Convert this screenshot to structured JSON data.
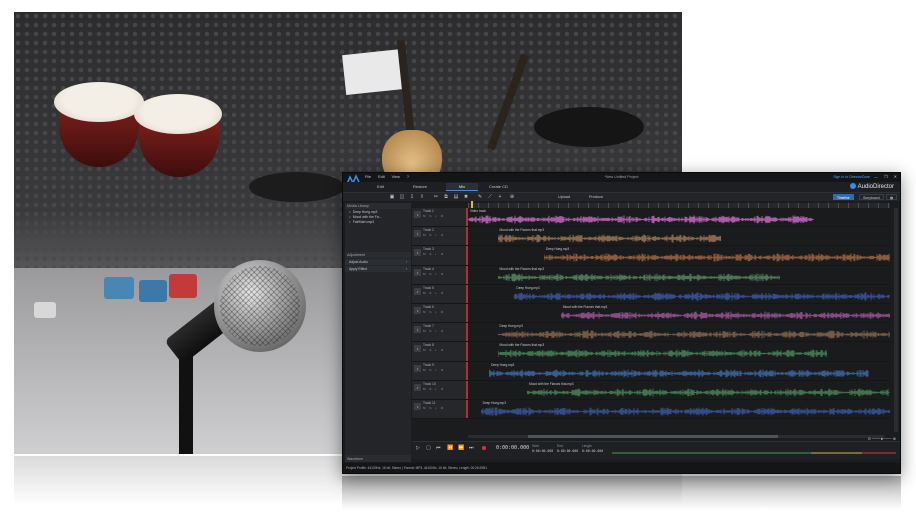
{
  "app": {
    "title": "*New Untitled Project",
    "brand": "AudioDirector",
    "sign_in": "Sign in to DirectorZone",
    "menu": [
      "File",
      "Edit",
      "View",
      "?"
    ],
    "win_controls": [
      "—",
      "❐",
      "✕"
    ]
  },
  "modes": [
    {
      "label": "Edit",
      "active": false
    },
    {
      "label": "Restore",
      "active": false
    },
    {
      "label": "Mix",
      "active": true
    },
    {
      "label": "Create CD",
      "active": false
    }
  ],
  "toolbar": {
    "icons": [
      "folder-icon",
      "save-icon",
      "import-icon",
      "export-icon",
      "cut-icon",
      "copy-icon",
      "paste-icon",
      "delete-icon",
      "pencil-icon",
      "fade-icon",
      "add-icon",
      "zoom-icon"
    ],
    "glyphs": [
      "▣",
      "◫",
      "⇩",
      "⇪",
      "✂",
      "⧉",
      "▤",
      "✖",
      "✎",
      "⟋",
      "+",
      "⊕"
    ],
    "upload_label": "Upload",
    "produce_label": "Produce",
    "view_timeline": "Timeline",
    "view_storyboard": "Storyboard"
  },
  "sidebar": {
    "media_title": "Media Library",
    "media_items": [
      "Deep Hueg.mp3",
      "Mood with the Fa...",
      "FatHiden.mp3"
    ],
    "adjustment_title": "Adjustment",
    "adjust_items": [
      "Adjust Audio",
      "Apply Effect"
    ],
    "waveform_title": "Waveform"
  },
  "tracks": [
    {
      "name": "Track 1",
      "clip": "Video track",
      "color": "#cf6fc9",
      "start": 0.0,
      "end": 0.82
    },
    {
      "name": "Track 2",
      "clip": "Mood with the Flavors that.mp3",
      "color": "#a87c58",
      "start": 0.07,
      "end": 0.6
    },
    {
      "name": "Track 3",
      "clip": "Deep Hueg.mp3",
      "color": "#a86a47",
      "start": 0.18,
      "end": 1.0
    },
    {
      "name": "Track 4",
      "clip": "Mood with the Flavors that.mp3",
      "color": "#5c8e6a",
      "start": 0.07,
      "end": 0.74
    },
    {
      "name": "Track 5",
      "clip": "Deep Hueg.mp3",
      "color": "#3e5aa6",
      "start": 0.11,
      "end": 1.0
    },
    {
      "name": "Track 6",
      "clip": "Mood with the Flavors that.mp3",
      "color": "#a05a9c",
      "start": 0.22,
      "end": 1.0
    },
    {
      "name": "Track 7",
      "clip": "Deep Hueg.mp3",
      "color": "#8e6a4c",
      "start": 0.07,
      "end": 1.0
    },
    {
      "name": "Track 8",
      "clip": "Mood with the Flavors that.mp3",
      "color": "#4d8a5d",
      "start": 0.07,
      "end": 0.85
    },
    {
      "name": "Track 9",
      "clip": "Deep Hueg.mp3",
      "color": "#3d6fb0",
      "start": 0.05,
      "end": 0.95
    },
    {
      "name": "Track 10",
      "clip": "Mood with the Flavors that.mp3",
      "color": "#4e8a5c",
      "start": 0.14,
      "end": 1.0
    },
    {
      "name": "Track 11",
      "clip": "Deep Hueg.mp3",
      "color": "#3a5aa0",
      "start": 0.03,
      "end": 1.0
    }
  ],
  "transport": {
    "buttons": [
      "▷",
      "▢",
      "⏮",
      "⏪",
      "⏩",
      "⏭"
    ],
    "timecode": "0:00:00.000",
    "start_label": "Start",
    "start_value": "0:00:00.000",
    "end_label": "End",
    "end_value": "0:00:00.000",
    "length_label": "Length",
    "length_value": "0:00:00.000",
    "zoom_label": "⊖ ───●─── ⊕"
  },
  "status": {
    "text": "Project Profile: 44100Hz, 16 bit, Stereo | Format: MP3, 44100Hz, 16 bit, Stereo, Length: 00:26:29B1"
  },
  "colors": {
    "accent": "#3c8ce6",
    "playhead": "#e3b63a",
    "record": "#d1363f",
    "track_border": "#b0303a"
  }
}
